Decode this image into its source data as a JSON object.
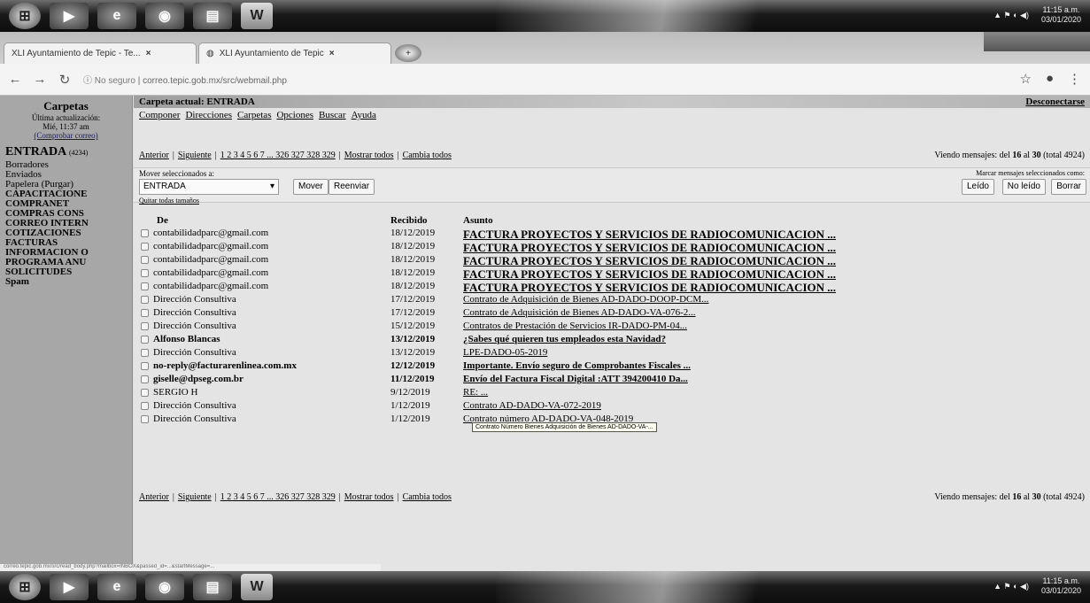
{
  "taskbar": {
    "clock_time": "11:15 a.m.",
    "clock_date": "03/01/2020"
  },
  "browser": {
    "tabs": [
      {
        "label": "XLI Ayuntamiento de Tepic - Te..."
      },
      {
        "label": "XLI Ayuntamiento de Tepic"
      }
    ],
    "url_prefix": "No seguro",
    "url": "correo.tepic.gob.mx/src/webmail.php"
  },
  "sidebar": {
    "title": "Carpetas",
    "last_update": "Última actualización:",
    "time": "Mié, 11:37 am",
    "check_mail": "(Comprobar correo)",
    "inbox": {
      "label": "ENTRADA",
      "count": "(4234)"
    },
    "folders": [
      "Borradores",
      "Enviados",
      "Papelera (Purgar)",
      "CAPACITACIONE",
      "COMPRANET",
      "COMPRAS CONS",
      "CORREO INTERN",
      "COTIZACIONES",
      "FACTURAS",
      "INFORMACION O",
      "PROGRAMA ANU",
      "SOLICITUDES",
      "Spam"
    ]
  },
  "main": {
    "current_folder": "Carpeta actual: ENTRADA",
    "logout": "Desconectarse",
    "menu": [
      "Componer",
      "Direcciones",
      "Carpetas",
      "Opciones",
      "Buscar",
      "Ayuda"
    ],
    "pager": {
      "prev": "Anterior",
      "next": "Siguiente",
      "pages": "1 2 3 4 5 6 7 ... 326 327 328 329",
      "show_all": "Mostrar todos",
      "toggle_all": "Cambia todos"
    },
    "viewing_prefix": "Viendo mensajes:",
    "viewing_from": "16",
    "viewing_to": "30",
    "viewing_total": "(total 4924)",
    "move_label": "Mover seleccionados a:",
    "move_select": "ENTRADA",
    "move_button": "Mover",
    "forward_button": "Reenviar",
    "clear_selection": "Quitar todas tamaños",
    "mark_label": "Marcar mensajes seleccionados como:",
    "read_button": "Leído",
    "unread_button": "No leído",
    "delete_button": "Borrar",
    "columns": {
      "from": "De",
      "received": "Recibido",
      "subject": "Asunto"
    },
    "tooltip": "Contrato Número Bienes Adquisición de Bienes AD-DADO-VA-...",
    "messages": [
      {
        "from": "contabilidadparc@gmail.com",
        "date": "18/12/2019",
        "subject": "FACTURA PROYECTOS Y SERVICIOS DE RADIOCOMUNICACION ...",
        "bold": "false",
        "big": "true"
      },
      {
        "from": "contabilidadparc@gmail.com",
        "date": "18/12/2019",
        "subject": "FACTURA PROYECTOS Y SERVICIOS DE RADIOCOMUNICACION ...",
        "bold": "false",
        "big": "true"
      },
      {
        "from": "contabilidadparc@gmail.com",
        "date": "18/12/2019",
        "subject": "FACTURA PROYECTOS Y SERVICIOS DE RADIOCOMUNICACION ...",
        "bold": "false",
        "big": "true"
      },
      {
        "from": "contabilidadparc@gmail.com",
        "date": "18/12/2019",
        "subject": "FACTURA PROYECTOS Y SERVICIOS DE RADIOCOMUNICACION ...",
        "bold": "false",
        "big": "true"
      },
      {
        "from": "contabilidadparc@gmail.com",
        "date": "18/12/2019",
        "subject": "FACTURA PROYECTOS Y SERVICIOS DE RADIOCOMUNICACION ...",
        "bold": "false",
        "big": "true"
      },
      {
        "from": "Dirección Consultiva",
        "date": "17/12/2019",
        "subject": "Contrato de Adquisición de Bienes AD-DADO-DOOP-DCM...",
        "bold": "false",
        "big": "false"
      },
      {
        "from": "Dirección Consultiva",
        "date": "17/12/2019",
        "subject": "Contrato de Adquisición de Bienes AD-DADO-VA-076-2...",
        "bold": "false",
        "big": "false"
      },
      {
        "from": "Dirección Consultiva",
        "date": "15/12/2019",
        "subject": "Contratos de Prestación de Servicios IR-DADO-PM-04...",
        "bold": "false",
        "big": "false"
      },
      {
        "from": "Alfonso Blancas",
        "date": "13/12/2019",
        "subject": "¿Sabes qué quieren tus empleados esta Navidad?",
        "bold": "true",
        "big": "false"
      },
      {
        "from": "Dirección Consultiva",
        "date": "13/12/2019",
        "subject": "LPE-DADO-05-2019",
        "bold": "false",
        "big": "false"
      },
      {
        "from": "no-reply@facturarenlinea.com.mx",
        "date": "12/12/2019",
        "subject": "Importante. Envío seguro de Comprobantes Fiscales ...",
        "bold": "true",
        "big": "false"
      },
      {
        "from": "giselle@dpseg.com.br",
        "date": "11/12/2019",
        "subject": "Envío del Factura Fiscal Digital :ATT 394200410 Da...",
        "bold": "true",
        "big": "false"
      },
      {
        "from": "SERGIO H",
        "date": "9/12/2019",
        "subject": "RE: ...",
        "bold": "false",
        "big": "false"
      },
      {
        "from": "Dirección Consultiva",
        "date": "1/12/2019",
        "subject": "Contrato AD-DADO-VA-072-2019",
        "bold": "false",
        "big": "false"
      },
      {
        "from": "Dirección Consultiva",
        "date": "1/12/2019",
        "subject": "Contrato número AD-DADO-VA-048-2019",
        "bold": "false",
        "big": "false"
      }
    ]
  },
  "statusbar": "correo.tepic.gob.mx/src/read_body.php?mailbox=INBOX&passed_id=...&startMessage=..."
}
